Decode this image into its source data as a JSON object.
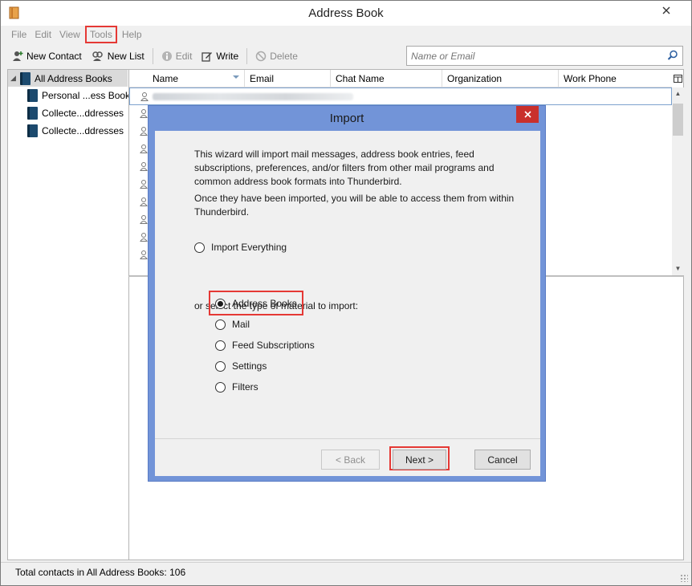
{
  "window": {
    "title": "Address Book"
  },
  "menu": [
    "File",
    "Edit",
    "View",
    "Tools",
    "Help"
  ],
  "toolbar": {
    "new_contact": "New Contact",
    "new_list": "New List",
    "edit": "Edit",
    "write": "Write",
    "delete": "Delete"
  },
  "search": {
    "placeholder": "Name or Email"
  },
  "sidebar": {
    "items": [
      "All Address Books",
      "Personal ...ess Book",
      "Collecte...ddresses",
      "Collecte...ddresses"
    ]
  },
  "list": {
    "columns": [
      "Name",
      "Email",
      "Chat Name",
      "Organization",
      "Work Phone"
    ]
  },
  "status": {
    "text": "Total contacts in All Address Books: 106"
  },
  "dialog": {
    "title": "Import",
    "intro1": "This wizard will import mail messages, address book entries, feed subscriptions, preferences, and/or filters from other mail programs and common address book formats into Thunderbird.",
    "intro2": "Once they have been imported, you will be able to access them from within Thunderbird.",
    "import_everything": "Import Everything",
    "select_label": "or select the type of material to import:",
    "options": [
      "Address Books",
      "Mail",
      "Feed Subscriptions",
      "Settings",
      "Filters"
    ],
    "selected": "Address Books",
    "back": "< Back",
    "next": "Next >",
    "cancel": "Cancel"
  },
  "colors": {
    "dialog_frame": "#7294d8",
    "highlight": "#e53935",
    "close_red": "#c9302c"
  }
}
